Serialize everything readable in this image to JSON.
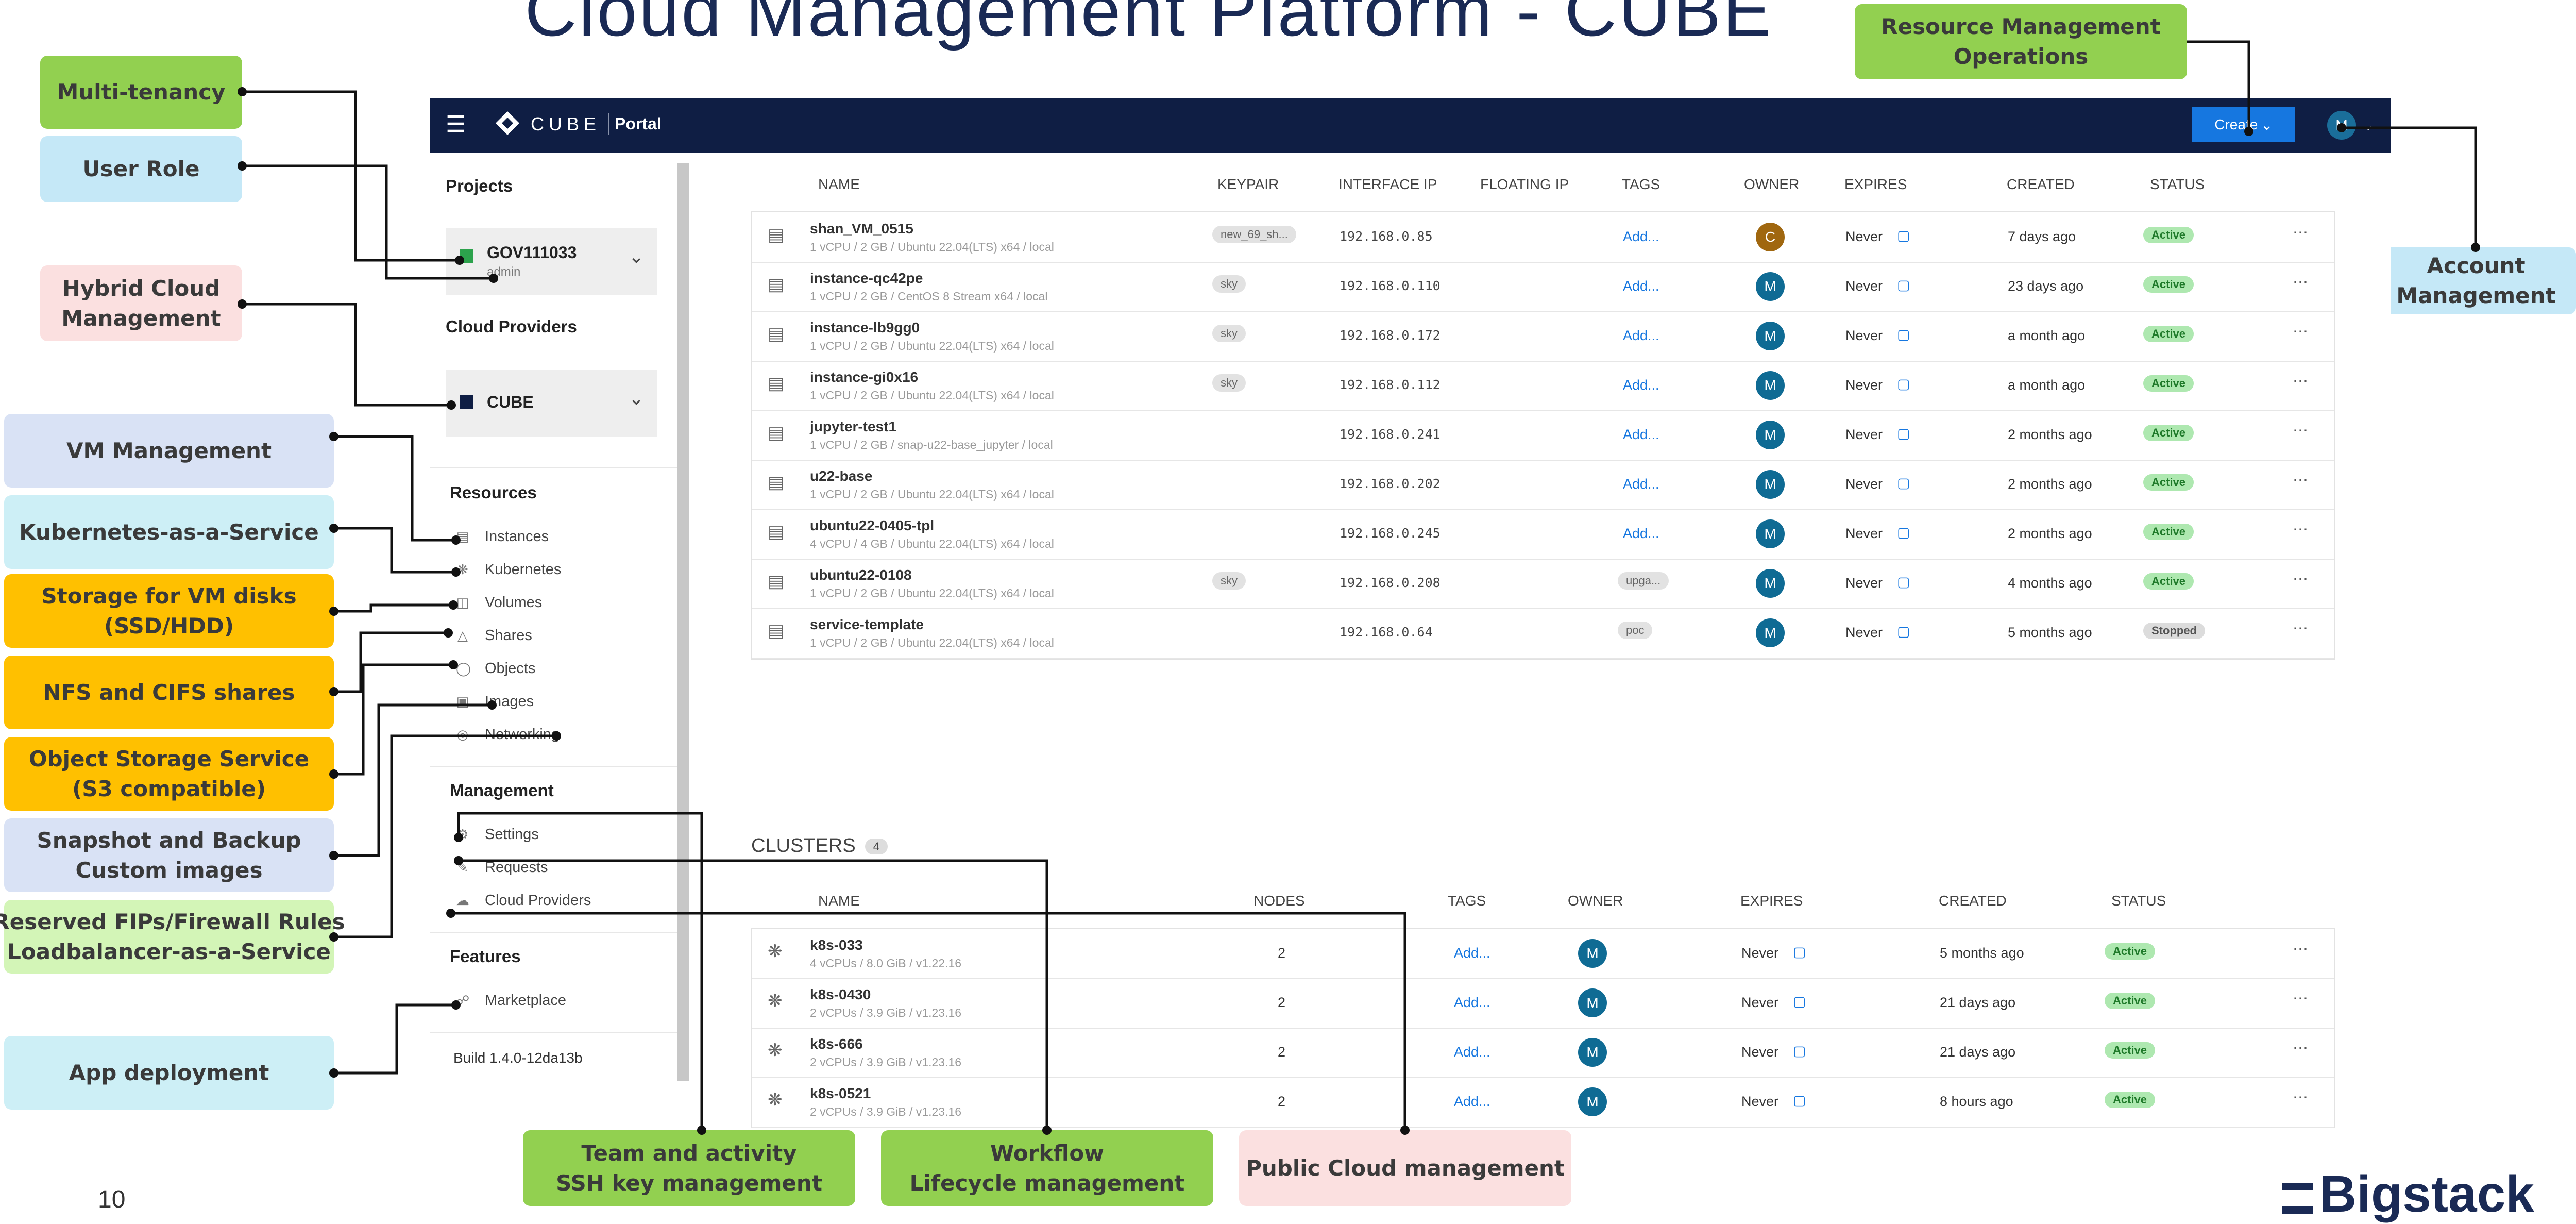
{
  "title": "Cloud Management Platform - CUBE",
  "page_number": "10",
  "logo_text": "Bigstack",
  "callouts": {
    "multi_tenancy": "Multi-tenancy",
    "user_role": "User Role",
    "hybrid_cloud": [
      "Hybrid Cloud",
      "Management"
    ],
    "vm_management": "VM Management",
    "kubernetes": "Kubernetes-as-a-Service",
    "storage": [
      "Storage for VM disks",
      "(SSD/HDD)"
    ],
    "nfs": "NFS and CIFS shares",
    "object_storage": [
      "Object Storage Service",
      "(S3 compatible)"
    ],
    "snapshot": [
      "Snapshot and Backup",
      "Custom images"
    ],
    "reserved": [
      "Reserved FIPs/Firewall Rules",
      "Loadbalancer-as-a-Service"
    ],
    "app_deployment": "App deployment",
    "resource_ops": [
      "Resource Management",
      "Operations"
    ],
    "account": [
      "Account",
      "Management"
    ],
    "team": [
      "Team and activity",
      "SSH key management"
    ],
    "workflow": [
      "Workflow",
      "Lifecycle management"
    ],
    "public_cloud": "Public Cloud management"
  },
  "portal": {
    "brand": "CUBE",
    "section": "Portal",
    "create_label": "Create",
    "account_initial": "M",
    "sidebar": {
      "projects_heading": "Projects",
      "project_name": "GOV111033",
      "project_role": "admin",
      "cloud_providers_heading": "Cloud Providers",
      "provider_name": "CUBE",
      "resources_heading": "Resources",
      "resources": [
        "Instances",
        "Kubernetes",
        "Volumes",
        "Shares",
        "Objects",
        "Images",
        "Networking"
      ],
      "management_heading": "Management",
      "management": [
        "Settings",
        "Requests",
        "Cloud Providers"
      ],
      "features_heading": "Features",
      "features": [
        "Marketplace"
      ],
      "build": "Build 1.4.0-12da13b"
    },
    "instances": {
      "headers": [
        "NAME",
        "KEYPAIR",
        "INTERFACE IP",
        "FLOATING IP",
        "TAGS",
        "OWNER",
        "EXPIRES",
        "CREATED",
        "STATUS"
      ],
      "rows": [
        {
          "name": "shan_VM_0515",
          "spec": "1 vCPU / 2 GB / Ubuntu 22.04(LTS) x64 / local",
          "keypair": "new_69_sh...",
          "ip": "192.168.0.85",
          "tag": "Add...",
          "tag_link": true,
          "owner": "C",
          "owner_color": "#a0670f",
          "expires": "Never",
          "created": "7 days ago",
          "status": "Active"
        },
        {
          "name": "instance-qc42pe",
          "spec": "1 vCPU / 2 GB / CentOS 8 Stream x64 / local",
          "keypair": "sky",
          "ip": "192.168.0.110",
          "tag": "Add...",
          "tag_link": true,
          "owner": "M",
          "owner_color": "#0f6b94",
          "expires": "Never",
          "created": "23 days ago",
          "status": "Active"
        },
        {
          "name": "instance-lb9gg0",
          "spec": "1 vCPU / 2 GB / Ubuntu 22.04(LTS) x64 / local",
          "keypair": "sky",
          "ip": "192.168.0.172",
          "tag": "Add...",
          "tag_link": true,
          "owner": "M",
          "owner_color": "#0f6b94",
          "expires": "Never",
          "created": "a month ago",
          "status": "Active"
        },
        {
          "name": "instance-gi0x16",
          "spec": "1 vCPU / 2 GB / Ubuntu 22.04(LTS) x64 / local",
          "keypair": "sky",
          "ip": "192.168.0.112",
          "tag": "Add...",
          "tag_link": true,
          "owner": "M",
          "owner_color": "#0f6b94",
          "expires": "Never",
          "created": "a month ago",
          "status": "Active"
        },
        {
          "name": "jupyter-test1",
          "spec": "1 vCPU / 2 GB / snap-u22-base_jupyter / local",
          "keypair": "",
          "ip": "192.168.0.241",
          "tag": "Add...",
          "tag_link": true,
          "owner": "M",
          "owner_color": "#0f6b94",
          "expires": "Never",
          "created": "2 months ago",
          "status": "Active"
        },
        {
          "name": "u22-base",
          "spec": "1 vCPU / 2 GB / Ubuntu 22.04(LTS) x64 / local",
          "keypair": "",
          "ip": "192.168.0.202",
          "tag": "Add...",
          "tag_link": true,
          "owner": "M",
          "owner_color": "#0f6b94",
          "expires": "Never",
          "created": "2 months ago",
          "status": "Active"
        },
        {
          "name": "ubuntu22-0405-tpl",
          "spec": "4 vCPU / 4 GB / Ubuntu 22.04(LTS) x64 / local",
          "keypair": "",
          "ip": "192.168.0.245",
          "tag": "Add...",
          "tag_link": true,
          "owner": "M",
          "owner_color": "#0f6b94",
          "expires": "Never",
          "created": "2 months ago",
          "status": "Active"
        },
        {
          "name": "ubuntu22-0108",
          "spec": "1 vCPU / 2 GB / Ubuntu 22.04(LTS) x64 / local",
          "keypair": "sky",
          "ip": "192.168.0.208",
          "tag": "upga...",
          "tag_link": false,
          "owner": "M",
          "owner_color": "#0f6b94",
          "expires": "Never",
          "created": "4 months ago",
          "status": "Active"
        },
        {
          "name": "service-template",
          "spec": "1 vCPU / 2 GB / Ubuntu 22.04(LTS) x64 / local",
          "keypair": "",
          "ip": "192.168.0.64",
          "tag": "poc",
          "tag_link": false,
          "owner": "M",
          "owner_color": "#0f6b94",
          "expires": "Never",
          "created": "5 months ago",
          "status": "Stopped"
        }
      ]
    },
    "clusters": {
      "heading": "CLUSTERS",
      "count": "4",
      "headers": [
        "NAME",
        "NODES",
        "TAGS",
        "OWNER",
        "EXPIRES",
        "CREATED",
        "STATUS"
      ],
      "rows": [
        {
          "name": "k8s-033",
          "spec": "4 vCPUs / 8.0 GiB / v1.22.16",
          "nodes": "2",
          "tag": "Add...",
          "owner": "M",
          "expires": "Never",
          "created": "5 months ago",
          "status": "Active"
        },
        {
          "name": "k8s-0430",
          "spec": "2 vCPUs / 3.9 GiB / v1.23.16",
          "nodes": "2",
          "tag": "Add...",
          "owner": "M",
          "expires": "Never",
          "created": "21 days ago",
          "status": "Active"
        },
        {
          "name": "k8s-666",
          "spec": "2 vCPUs / 3.9 GiB / v1.23.16",
          "nodes": "2",
          "tag": "Add...",
          "owner": "M",
          "expires": "Never",
          "created": "21 days ago",
          "status": "Active"
        },
        {
          "name": "k8s-0521",
          "spec": "2 vCPUs / 3.9 GiB / v1.23.16",
          "nodes": "2",
          "tag": "Add...",
          "owner": "M",
          "expires": "Never",
          "created": "8 hours ago",
          "status": "Active"
        }
      ]
    }
  }
}
